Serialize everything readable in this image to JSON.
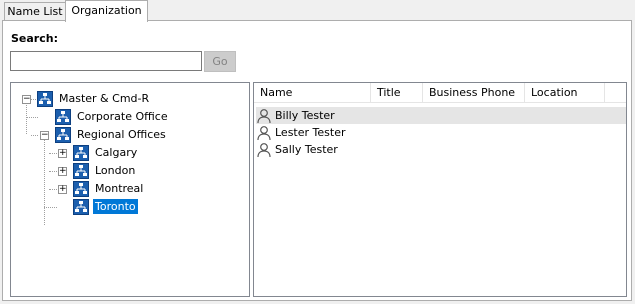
{
  "tabs": [
    {
      "label": "Name List",
      "active": false
    },
    {
      "label": "Organization",
      "active": true
    }
  ],
  "search": {
    "label": "Search:",
    "value": "",
    "placeholder": "",
    "go_label": "Go"
  },
  "tree": {
    "root": {
      "label": "Master & Cmd-R",
      "expanded": true
    },
    "corporate": {
      "label": "Corporate Office"
    },
    "regional": {
      "label": "Regional Offices",
      "expanded": true
    },
    "calgary": {
      "label": "Calgary",
      "expanded": false
    },
    "london": {
      "label": "London",
      "expanded": false
    },
    "montreal": {
      "label": "Montreal",
      "expanded": false
    },
    "toronto": {
      "label": "Toronto",
      "selected": true
    }
  },
  "grid": {
    "columns": [
      "Name",
      "Title",
      "Business Phone",
      "Location"
    ],
    "rows": [
      {
        "name": "Billy Tester",
        "title": "",
        "phone": "",
        "location": "",
        "selected": true
      },
      {
        "name": "Lester Tester",
        "title": "",
        "phone": "",
        "location": "",
        "selected": false
      },
      {
        "name": "Sally Tester",
        "title": "",
        "phone": "",
        "location": "",
        "selected": false
      }
    ]
  },
  "colors": {
    "selection": "#0078d7",
    "row_highlight": "#e5e5e5",
    "org_icon_blue": "#1c5fae"
  },
  "icons": {
    "org_node": "org-chart-icon",
    "person": "person-icon",
    "expand": "plus-box",
    "collapse": "minus-box"
  }
}
